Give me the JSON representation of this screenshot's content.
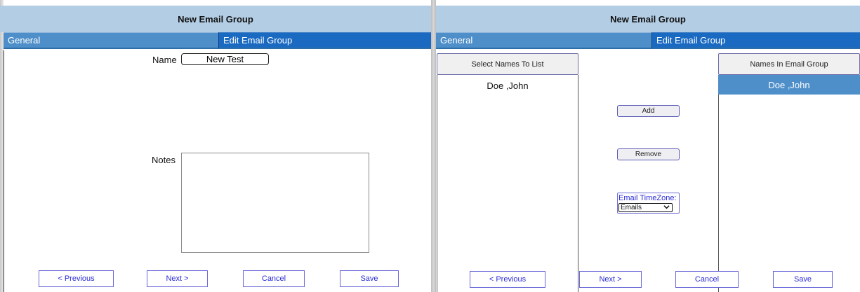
{
  "left_panel": {
    "title": "New Email Group",
    "tabs": [
      "General",
      "Edit Email Group"
    ],
    "name_label": "Name",
    "name_value": "New Test",
    "notes_label": "Notes",
    "notes_value": "",
    "buttons": {
      "previous": "< Previous",
      "next": "Next >",
      "cancel": "Cancel",
      "save": "Save"
    }
  },
  "right_panel": {
    "title": "New Email Group",
    "tabs": [
      "General",
      "Edit Email Group"
    ],
    "available_list": {
      "header": "Select Names To List",
      "items": [
        "Doe ,John"
      ]
    },
    "group_list": {
      "header": "Names In Email Group",
      "items": [
        "Doe ,John"
      ]
    },
    "add_label": "Add",
    "remove_label": "Remove",
    "timezone": {
      "label": "Email TimeZone:",
      "selected": "Emails"
    },
    "buttons": {
      "previous": "< Previous",
      "next": "Next >",
      "cancel": "Cancel",
      "save": "Save"
    }
  },
  "colors": {
    "title_bar": "#b3cde4",
    "tab_general": "#4f8fc9",
    "tab_active": "#1a6ac2",
    "button_text": "#2b2bd6",
    "selected_row": "#4f8fc9"
  },
  "icons": {
    "dropdown": "chevron-down-icon"
  }
}
